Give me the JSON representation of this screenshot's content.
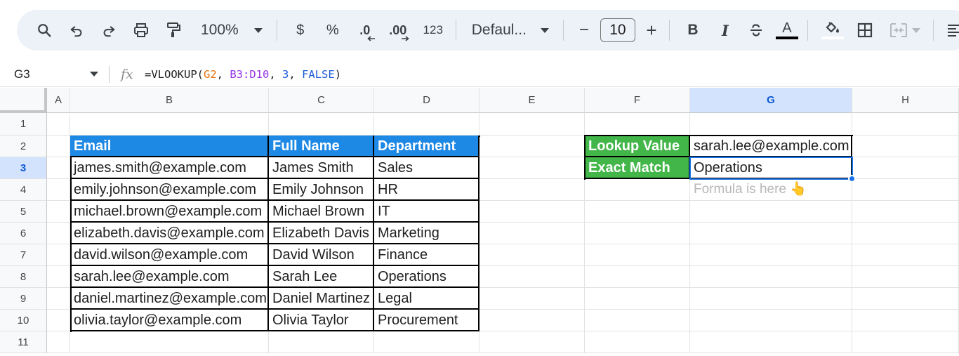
{
  "toolbar": {
    "zoom": "100%",
    "currency": "$",
    "percent": "%",
    "decrease_decimal": ".0",
    "increase_decimal": ".00",
    "number_format": "123",
    "font_name": "Defaul...",
    "font_size": "10",
    "minus": "−",
    "plus": "+",
    "bold": "B",
    "italic": "I",
    "text_color_letter": "A"
  },
  "formula_bar": {
    "name_box": "G3",
    "fx": "fx",
    "formula_prefix": "=VLOOKUP(",
    "arg1": "G2",
    "sep1": ", ",
    "arg2": "B3:D10",
    "sep2": ", ",
    "arg3": "3",
    "sep3": ", ",
    "arg4": "FALSE",
    "formula_suffix": ")"
  },
  "columns": [
    "A",
    "B",
    "C",
    "D",
    "E",
    "F",
    "G",
    "H"
  ],
  "selected_column": "G",
  "rows": [
    "1",
    "2",
    "3",
    "4",
    "5",
    "6",
    "7",
    "8",
    "9",
    "10",
    "11"
  ],
  "selected_row": "3",
  "table": {
    "headers": [
      "Email",
      "Full Name",
      "Department"
    ],
    "rows": [
      [
        "james.smith@example.com",
        "James Smith",
        "Sales"
      ],
      [
        "emily.johnson@example.com",
        "Emily Johnson",
        "HR"
      ],
      [
        "michael.brown@example.com",
        "Michael Brown",
        "IT"
      ],
      [
        "elizabeth.davis@example.com",
        "Elizabeth Davis",
        "Marketing"
      ],
      [
        "david.wilson@example.com",
        "David Wilson",
        "Finance"
      ],
      [
        "sarah.lee@example.com",
        "Sarah Lee",
        "Operations"
      ],
      [
        "daniel.martinez@example.com",
        "Daniel Martinez",
        "Legal"
      ],
      [
        "olivia.taylor@example.com",
        "Olivia Taylor",
        "Procurement"
      ]
    ]
  },
  "lookup": {
    "label_value": "Lookup Value",
    "value": "sarah.lee@example.com",
    "label_match": "Exact Match",
    "result": "Operations",
    "note": "Formula is here 👆"
  },
  "colors": {
    "header_blue": "#1e88e5",
    "header_green": "#43b649",
    "selection": "#1a73e8"
  }
}
